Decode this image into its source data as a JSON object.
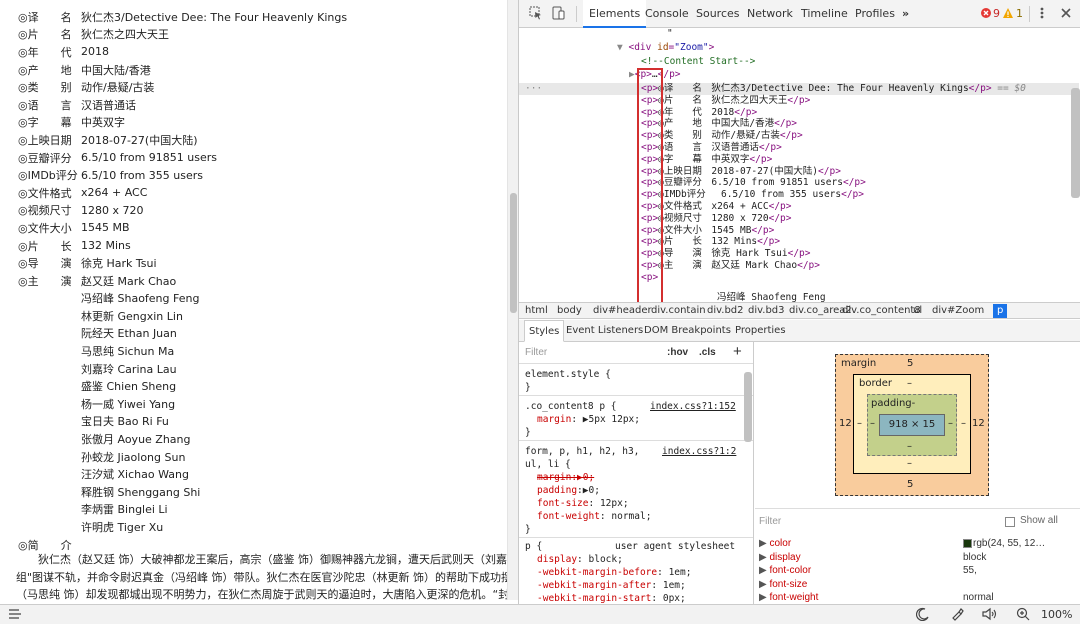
{
  "page": {
    "rows": [
      {
        "key": "◎译　　名",
        "value": "狄仁杰3/Detective Dee: The Four Heavenly Kings"
      },
      {
        "key": "◎片　　名",
        "value": "狄仁杰之四大天王"
      },
      {
        "key": "◎年　　代",
        "value": "2018"
      },
      {
        "key": "◎产　　地",
        "value": "中国大陆/香港"
      },
      {
        "key": "◎类　　别",
        "value": "动作/悬疑/古装"
      },
      {
        "key": "◎语　　言",
        "value": "汉语普通话"
      },
      {
        "key": "◎字　　幕",
        "value": "中英双字"
      },
      {
        "key": "◎上映日期",
        "value": "2018-07-27(中国大陆)"
      },
      {
        "key": "◎豆瓣评分",
        "value": "6.5/10 from 91851 users"
      },
      {
        "key": "◎IMDb评分",
        "value": " 6.5/10 from 355 users"
      },
      {
        "key": "◎文件格式",
        "value": "x264 + ACC"
      },
      {
        "key": "◎视频尺寸",
        "value": "1280 x 720"
      },
      {
        "key": "◎文件大小",
        "value": "1545 MB"
      },
      {
        "key": "◎片　　长",
        "value": "132 Mins"
      },
      {
        "key": "◎导　　演",
        "value": "徐克 Hark Tsui"
      },
      {
        "key": "◎主　　演",
        "value": "赵又廷 Mark Chao"
      }
    ],
    "cast": [
      "冯绍峰 Shaofeng Feng",
      "林更新 Gengxin Lin",
      "阮经天 Ethan Juan",
      "马思纯 Sichun Ma",
      "刘嘉玲 Carina Lau",
      "盛鉴 Chien Sheng",
      "杨一威 Yiwei Yang",
      "宝日夫 Bao Ri Fu",
      "张傲月 Aoyue Zhang",
      "孙蛟龙 Jiaolong Sun",
      "汪汐斌 Xichao Wang",
      "释胜钢 Shenggang Shi",
      "李炳雷 Binglei Li",
      "许明虎 Tiger Xu"
    ],
    "intro_key": "◎简　　介",
    "synopsis_1": "　　狄仁杰（赵又廷 饰）大破神都龙王案后，高宗（盛鉴 饰）御赐神器亢龙锏，遭天后武则天（刘嘉玲",
    "synopsis_2": "组\"图谋不轨，并命令尉迟真金（冯绍峰 饰）带队。狄仁杰在医官沙陀忠（林更新 饰）的帮助下成功摆脱",
    "synopsis_3": "（马思纯 饰）却发现都城出现不明势力，在狄仁杰周旋于武则天的逼迫时，大唐陷入更深的危机。“封喉"
  },
  "devtools": {
    "tabs": [
      "Elements",
      "Console",
      "Sources",
      "Network",
      "Timeline",
      "Profiles"
    ],
    "more": "»",
    "errors": "9",
    "warnings": "1",
    "quote_line": "\"",
    "div_open": {
      "tag": "<div",
      "attr": "id",
      "val": "\"Zoom\"",
      "close": ">"
    },
    "comment": "<!--Content Start-->",
    "p_empty": {
      "open": "<p>",
      "dots": "…",
      "close": "</p>"
    },
    "p_lines": [
      {
        "text": "◎译　　名　狄仁杰3/Detective Dee: The Four Heavenly Kings",
        "suffix": " == $0"
      },
      {
        "text": "◎片　　名　狄仁杰之四大天王",
        "suffix": ""
      },
      {
        "text": "◎年　　代　2018",
        "suffix": ""
      },
      {
        "text": "◎产　　地　中国大陆/香港",
        "suffix": ""
      },
      {
        "text": "◎类　　别　动作/悬疑/古装",
        "suffix": ""
      },
      {
        "text": "◎语　　言　汉语普通话",
        "suffix": ""
      },
      {
        "text": "◎字　　幕　中英双字",
        "suffix": ""
      },
      {
        "text": "◎上映日期　2018-07-27(中国大陆)",
        "suffix": ""
      },
      {
        "text": "◎豆瓣评分　6.5/10 from 91851 users",
        "suffix": ""
      },
      {
        "text": "◎IMDb评分　 6.5/10 from 355 users",
        "suffix": ""
      },
      {
        "text": "◎文件格式　x264 + ACC",
        "suffix": ""
      },
      {
        "text": "◎视频尺寸　1280 x 720",
        "suffix": ""
      },
      {
        "text": "◎文件大小　1545 MB",
        "suffix": ""
      },
      {
        "text": "◎片　　长　132 Mins",
        "suffix": ""
      },
      {
        "text": "◎导　　演　徐克 Hark Tsui",
        "suffix": ""
      },
      {
        "text": "◎主　　演　赵又廷 Mark Chao",
        "suffix": ""
      }
    ],
    "p_tag": "<p>",
    "p_close": "</p>",
    "last_partial": "冯绍峰 Shaofeng Feng",
    "breadcrumbs": [
      "html",
      "body",
      "div#header",
      "div.contain",
      "div.bd2",
      "div.bd3",
      "div.co_area2",
      "div.co_content8",
      "ul",
      "div#Zoom",
      "p"
    ],
    "subtabs": [
      "Styles",
      "Event Listeners",
      "DOM Breakpoints",
      "Properties"
    ],
    "filter_placeholder": "Filter",
    "hov": ":hov",
    "cls": ".cls",
    "plus": "+",
    "styles": {
      "element_style": "element.style {",
      "close": "}",
      "r1_sel": ".co_content8 p {",
      "r1_src": "index.css?1:152",
      "r1_prop": "margin",
      "r1_val": "▶5px 12px;",
      "r2_sel": "form, p, h1, h2, h3,",
      "r2_sel2": "ul, li {",
      "r2_src": "index.css?1:2",
      "r2_p1": "margin:▶0;",
      "r2_p2": "padding",
      "r2_v2": "▶0;",
      "r2_p3": "font-size",
      "r2_v3": "12px;",
      "r2_p4": "font-weight",
      "r2_v4": "normal;",
      "r3_sel": "p {",
      "r3_src": "user agent stylesheet",
      "r3_p1": "display",
      "r3_v1": "block;",
      "r3_p2": "-webkit-margin-before",
      "r3_v2": "1em;",
      "r3_p3": "-webkit-margin-after",
      "r3_v3": "1em;",
      "r3_p4": "-webkit-margin-start",
      "r3_v4": "0px;"
    },
    "box": {
      "margin_label": "margin",
      "margin_top": "5",
      "margin_bottom": "5",
      "margin_left": "12",
      "margin_right": "12",
      "border_label": "border",
      "border_top": "–",
      "border_bottom": "–",
      "border_left": "–",
      "border_right": "–",
      "padding_label": "padding-",
      "padding_bottom": "–",
      "padding_left": "–",
      "padding_right": "–",
      "content": "918 × 15",
      "content_bottom": "–",
      "margin_color": "#f9cc9d",
      "border_color": "#ffeebc",
      "padding_color": "#c3d08b",
      "content_color": "#8cb6c0"
    },
    "computed": {
      "filter": "Filter",
      "show_all": "Show all",
      "props": [
        {
          "name": "color",
          "value": "rgb(24, 55, 12…"
        },
        {
          "name": "display",
          "value": "block"
        },
        {
          "name": "font-color",
          "value": "55,"
        },
        {
          "name": "font-size",
          "value": ""
        },
        {
          "name": "font-weight",
          "value": "normal"
        }
      ],
      "swatch": "#18370c"
    }
  },
  "status": {
    "zoom": "100%"
  }
}
